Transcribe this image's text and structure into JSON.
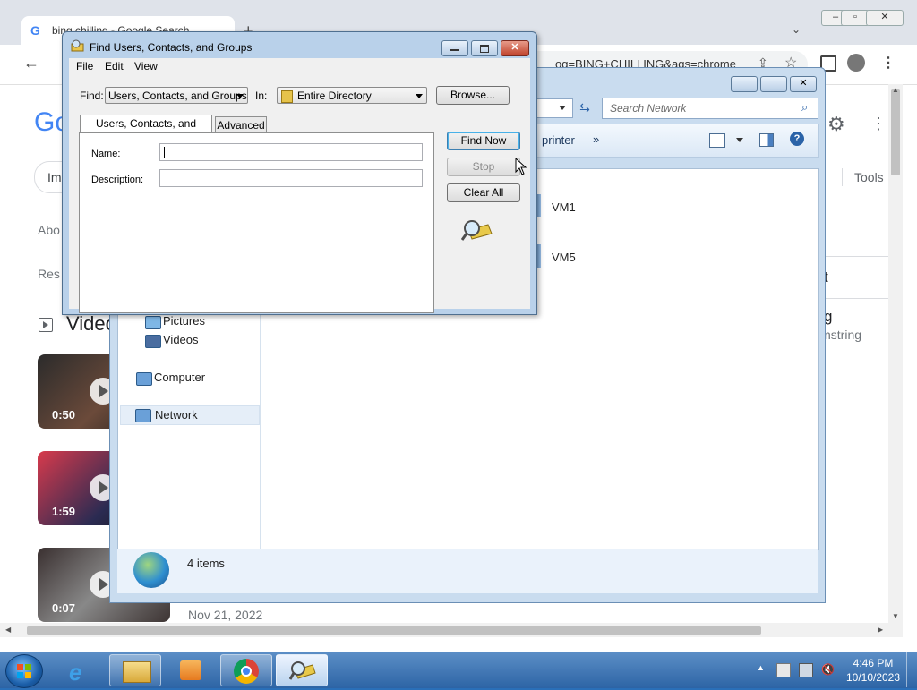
{
  "browser": {
    "tab_title": "bing chilling - Google Search",
    "address_fragment": "og=BING+CHILLING&aqs=chrome",
    "google_logo": "Go",
    "chip_label": "Im",
    "tools_label": "Tools",
    "about_text": "Abo",
    "results_text": "Res",
    "videos_heading": "Video",
    "right_snippet_1": "t",
    "right_snippet_2": "g",
    "right_snippet_3": "nstring",
    "videos": [
      {
        "duration": "0:50"
      },
      {
        "duration": "1:59"
      },
      {
        "duration": "0:07"
      }
    ],
    "date_text": "Nov 21, 2022"
  },
  "explorer": {
    "search_placeholder": "Search Network",
    "cmd_printer": "printer",
    "cmd_more": "»",
    "nav_items": [
      {
        "label": "Pictures"
      },
      {
        "label": "Videos"
      },
      {
        "label": "Computer"
      },
      {
        "label": "Network"
      }
    ],
    "items": [
      {
        "label": "VM1"
      },
      {
        "label": "VM5"
      }
    ],
    "status_count": "4 items"
  },
  "dialog": {
    "title": "Find Users, Contacts, and Groups",
    "menu": [
      "File",
      "Edit",
      "View"
    ],
    "find_label": "Find:",
    "find_value": "Users, Contacts, and Groups",
    "in_label": "In:",
    "in_value": "Entire Directory",
    "browse_button": "Browse...",
    "tabs": [
      "Users, Contacts, and Groups",
      "Advanced"
    ],
    "name_label": "Name:",
    "name_value": "",
    "description_label": "Description:",
    "description_value": "",
    "find_now_button": "Find Now",
    "stop_button": "Stop",
    "clear_all_button": "Clear All"
  },
  "taskbar": {
    "time": "4:46 PM",
    "date": "10/10/2023"
  }
}
